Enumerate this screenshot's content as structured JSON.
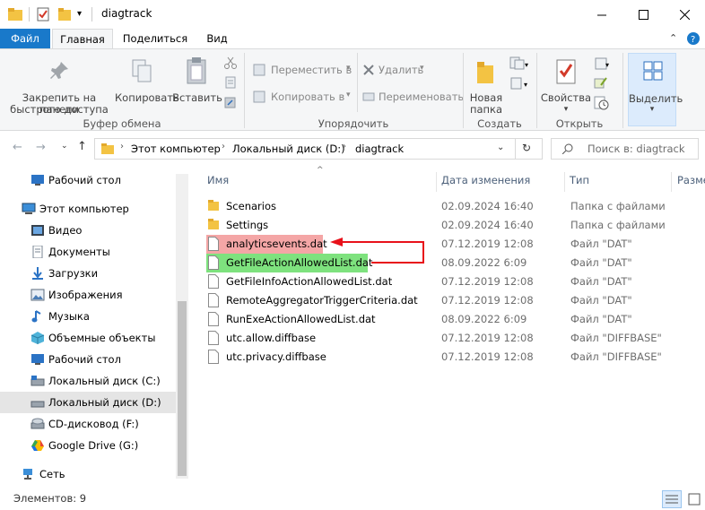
{
  "window": {
    "title": "diagtrack"
  },
  "tabs": {
    "file": "Файл",
    "home": "Главная",
    "share": "Поделиться",
    "view": "Вид"
  },
  "ribbon": {
    "pin": "Закрепить на панели быстрого доступа",
    "pin_line1": "Закрепить на панели",
    "pin_line2": "быстрого доступа",
    "copy": "Копировать",
    "paste": "Вставить",
    "clipboard_group": "Буфер обмена",
    "move_to": "Переместить в",
    "copy_to": "Копировать в",
    "delete": "Удалить",
    "rename": "Переименовать",
    "organize_group": "Упорядочить",
    "new_folder_line1": "Новая",
    "new_folder_line2": "папка",
    "create_group": "Создать",
    "properties": "Свойства",
    "open_group": "Открыть",
    "select": "Выделить"
  },
  "address": {
    "crumbs": [
      "Этот компьютер",
      "Локальный диск (D:)",
      "diagtrack"
    ],
    "search_placeholder": "Поиск в: diagtrack"
  },
  "nav": {
    "items": [
      {
        "label": "Рабочий стол",
        "icon": "desktop-icon"
      },
      {
        "label": "Этот компьютер",
        "icon": "computer-icon"
      },
      {
        "label": "Видео",
        "icon": "video-icon"
      },
      {
        "label": "Документы",
        "icon": "documents-icon"
      },
      {
        "label": "Загрузки",
        "icon": "downloads-icon"
      },
      {
        "label": "Изображения",
        "icon": "pictures-icon"
      },
      {
        "label": "Музыка",
        "icon": "music-icon"
      },
      {
        "label": "Объемные объекты",
        "icon": "3d-objects-icon"
      },
      {
        "label": "Рабочий стол",
        "icon": "desktop-icon"
      },
      {
        "label": "Локальный диск (C:)",
        "icon": "drive-icon"
      },
      {
        "label": "Локальный диск (D:)",
        "icon": "drive-icon"
      },
      {
        "label": "CD-дисковод (F:)",
        "icon": "cd-drive-icon"
      },
      {
        "label": "Google Drive (G:)",
        "icon": "google-drive-icon"
      },
      {
        "label": "Сеть",
        "icon": "network-icon"
      }
    ]
  },
  "list": {
    "headers": {
      "name": "Имя",
      "date": "Дата изменения",
      "type": "Тип",
      "size": "Разме"
    },
    "rows": [
      {
        "name": "Scenarios",
        "date": "02.09.2024 16:40",
        "type": "Папка с файлами",
        "kind": "folder"
      },
      {
        "name": "Settings",
        "date": "02.09.2024 16:40",
        "type": "Папка с файлами",
        "kind": "folder"
      },
      {
        "name": "analyticsevents.dat",
        "date": "07.12.2019 12:08",
        "type": "Файл \"DAT\"",
        "kind": "file"
      },
      {
        "name": "GetFileActionAllowedList.dat",
        "date": "08.09.2022 6:09",
        "type": "Файл \"DAT\"",
        "kind": "file"
      },
      {
        "name": "GetFileInfoActionAllowedList.dat",
        "date": "07.12.2019 12:08",
        "type": "Файл \"DAT\"",
        "kind": "file"
      },
      {
        "name": "RemoteAggregatorTriggerCriteria.dat",
        "date": "07.12.2019 12:08",
        "type": "Файл \"DAT\"",
        "kind": "file"
      },
      {
        "name": "RunExeActionAllowedList.dat",
        "date": "08.09.2022 6:09",
        "type": "Файл \"DAT\"",
        "kind": "file"
      },
      {
        "name": "utc.allow.diffbase",
        "date": "07.12.2019 12:08",
        "type": "Файл \"DIFFBASE\"",
        "kind": "file"
      },
      {
        "name": "utc.privacy.diffbase",
        "date": "07.12.2019 12:08",
        "type": "Файл \"DIFFBASE\"",
        "kind": "file"
      }
    ]
  },
  "status": {
    "items_count": "Элементов: 9"
  },
  "colors": {
    "file_tab": "#1979ca",
    "highlight_red": "#f4a6a6",
    "highlight_green": "#7ee27e",
    "arrow_red": "#e8111a"
  }
}
